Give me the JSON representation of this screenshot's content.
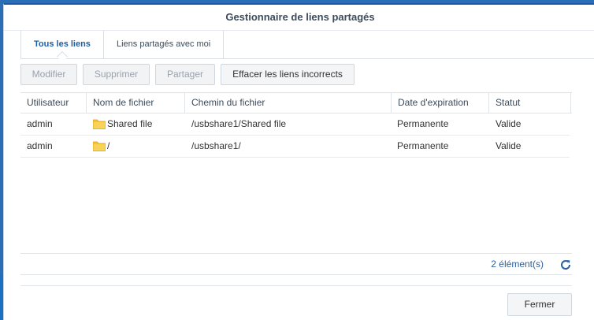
{
  "dialog": {
    "title": "Gestionnaire de liens partagés"
  },
  "tabs": [
    {
      "label": "Tous les liens",
      "active": true
    },
    {
      "label": "Liens partagés avec moi",
      "active": false
    }
  ],
  "toolbar": {
    "modify_label": "Modifier",
    "delete_label": "Supprimer",
    "share_label": "Partager",
    "clear_invalid_label": "Effacer les liens incorrects"
  },
  "table": {
    "columns": [
      "Utilisateur",
      "Nom de fichier",
      "Chemin du fichier",
      "Date d'expiration",
      "Statut"
    ],
    "rows": [
      {
        "user": "admin",
        "file": "Shared file",
        "path": "/usbshare1/Shared file",
        "expiration": "Permanente",
        "status": "Valide",
        "icon": "folder-icon"
      },
      {
        "user": "admin",
        "file": "/",
        "path": "/usbshare1/",
        "expiration": "Permanente",
        "status": "Valide",
        "icon": "folder-icon"
      }
    ]
  },
  "status": {
    "count": "2 élément(s)",
    "refresh_icon": "refresh-icon"
  },
  "footer": {
    "close_label": "Fermer"
  },
  "colors": {
    "accent": "#1f5fa3",
    "title_bar": "#1a5aa6",
    "folder": "#f5c542"
  }
}
